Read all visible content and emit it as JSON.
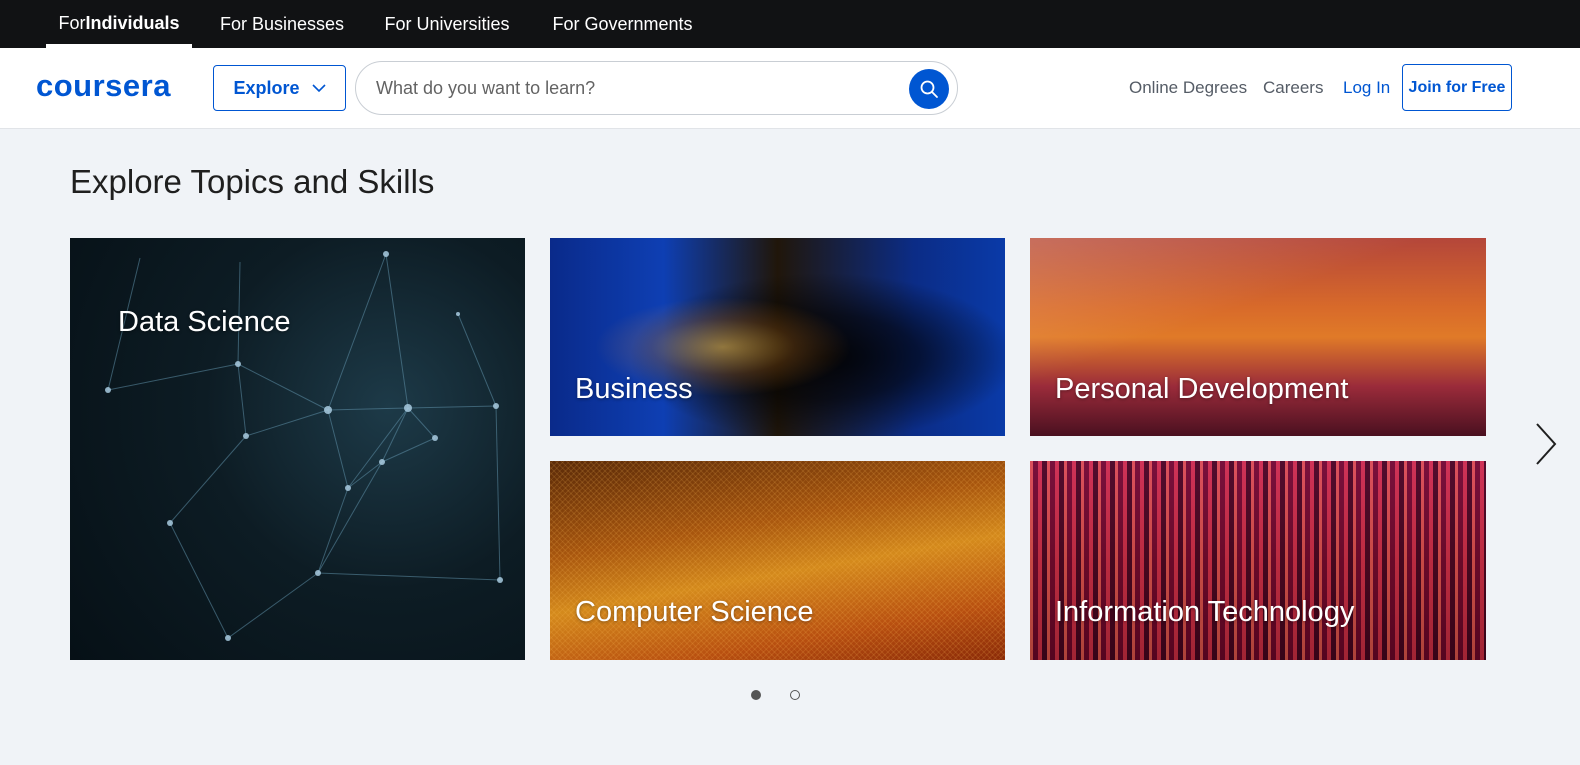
{
  "audience_nav": {
    "individuals_prefix": "For ",
    "individuals_bold": "Individuals",
    "businesses": "For Businesses",
    "universities": "For Universities",
    "governments": "For Governments"
  },
  "header": {
    "logo": "coursera",
    "explore_label": "Explore",
    "search_placeholder": "What do you want to learn?",
    "online_degrees": "Online Degrees",
    "careers": "Careers",
    "log_in": "Log In",
    "join_for_free": "Join for Free"
  },
  "section": {
    "title": "Explore Topics and Skills",
    "topics": [
      {
        "label": "Data Science"
      },
      {
        "label": "Business"
      },
      {
        "label": "Personal Development"
      },
      {
        "label": "Computer Science"
      },
      {
        "label": "Information Technology"
      }
    ]
  },
  "carousel": {
    "page_count": 2,
    "active_page": 1
  },
  "colors": {
    "brand_blue": "#0056d2",
    "top_bar": "#111214",
    "page_bg": "#f0f3f7"
  },
  "icons": [
    "chevron-down-icon",
    "search-icon",
    "chevron-right-icon"
  ]
}
